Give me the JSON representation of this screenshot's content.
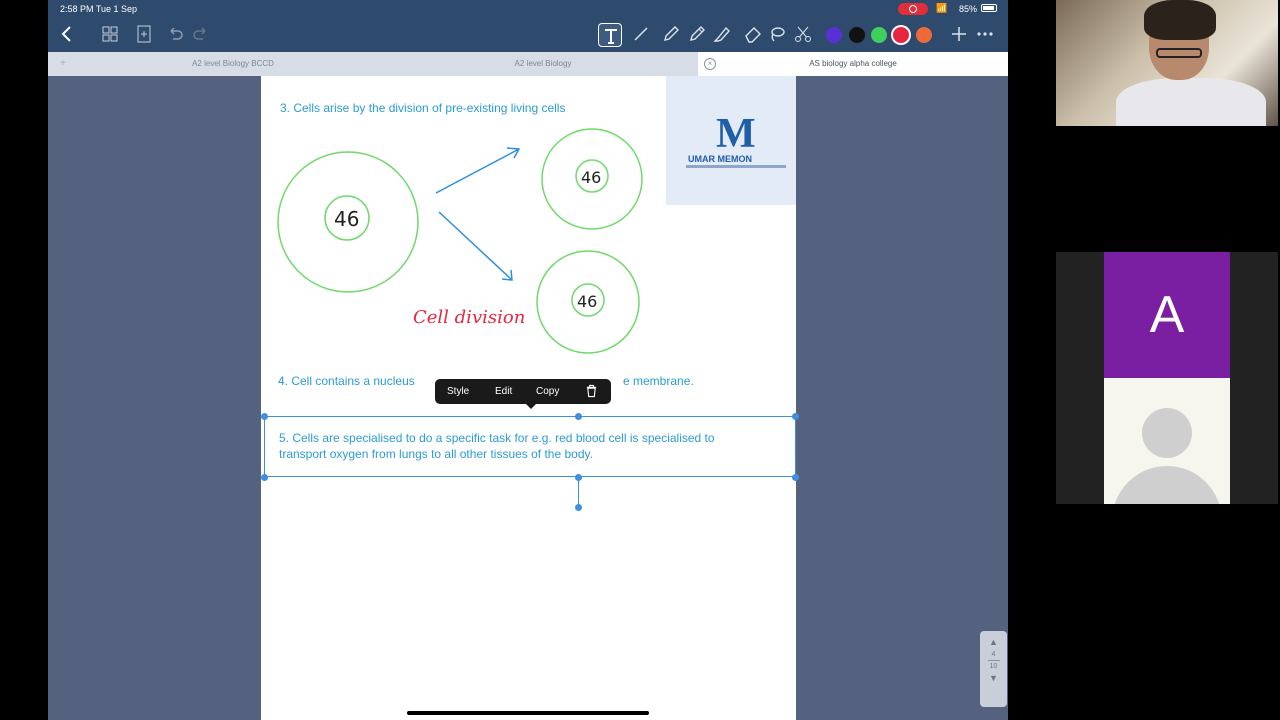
{
  "status_bar": {
    "time": "2:58 PM   Tue 1 Sep",
    "battery": "85%"
  },
  "toolbar": {
    "icons": [
      "back-chevron-icon",
      "thumbnails-icon",
      "add-page-icon",
      "undo-icon",
      "redo-icon",
      "text-tool-icon",
      "line-tool-icon",
      "pen-icon",
      "pencil-icon",
      "highlighter-icon",
      "eraser-icon",
      "lasso-icon",
      "scissors-icon",
      "add-icon",
      "more-icon"
    ],
    "colors": [
      "#5b2fd6",
      "#111111",
      "#3fcf5c",
      "#e8263f",
      "#ef6a3a"
    ],
    "selected_color": "#e8263f"
  },
  "tabs": [
    {
      "label": "A2 level Biology BCCD"
    },
    {
      "label": "A2 level Biology"
    },
    {
      "label": "AS biology alpha college"
    }
  ],
  "document": {
    "point3": "3. Cells arise by the division of pre-existing living cells",
    "parent_cell": "46",
    "daughter_cell_1": "46",
    "daughter_cell_2": "46",
    "handwritten_note": "Cell division",
    "point4_start": "4. Cell contains a nucleus",
    "point4_end": "e membrane.",
    "point5_line1": "5. Cells are specialised to do a specific task for e.g. red blood cell is specialised to",
    "point5_line2": "transport oxygen from lungs to all other tissues of the body.",
    "logo_letter": "M",
    "logo_name": "UMAR MEMON"
  },
  "context_menu": {
    "style": "Style",
    "edit": "Edit",
    "copy": "Copy"
  },
  "page_nav": {
    "current": "4",
    "total": "10"
  },
  "participants": {
    "avatar_letter": "A"
  }
}
